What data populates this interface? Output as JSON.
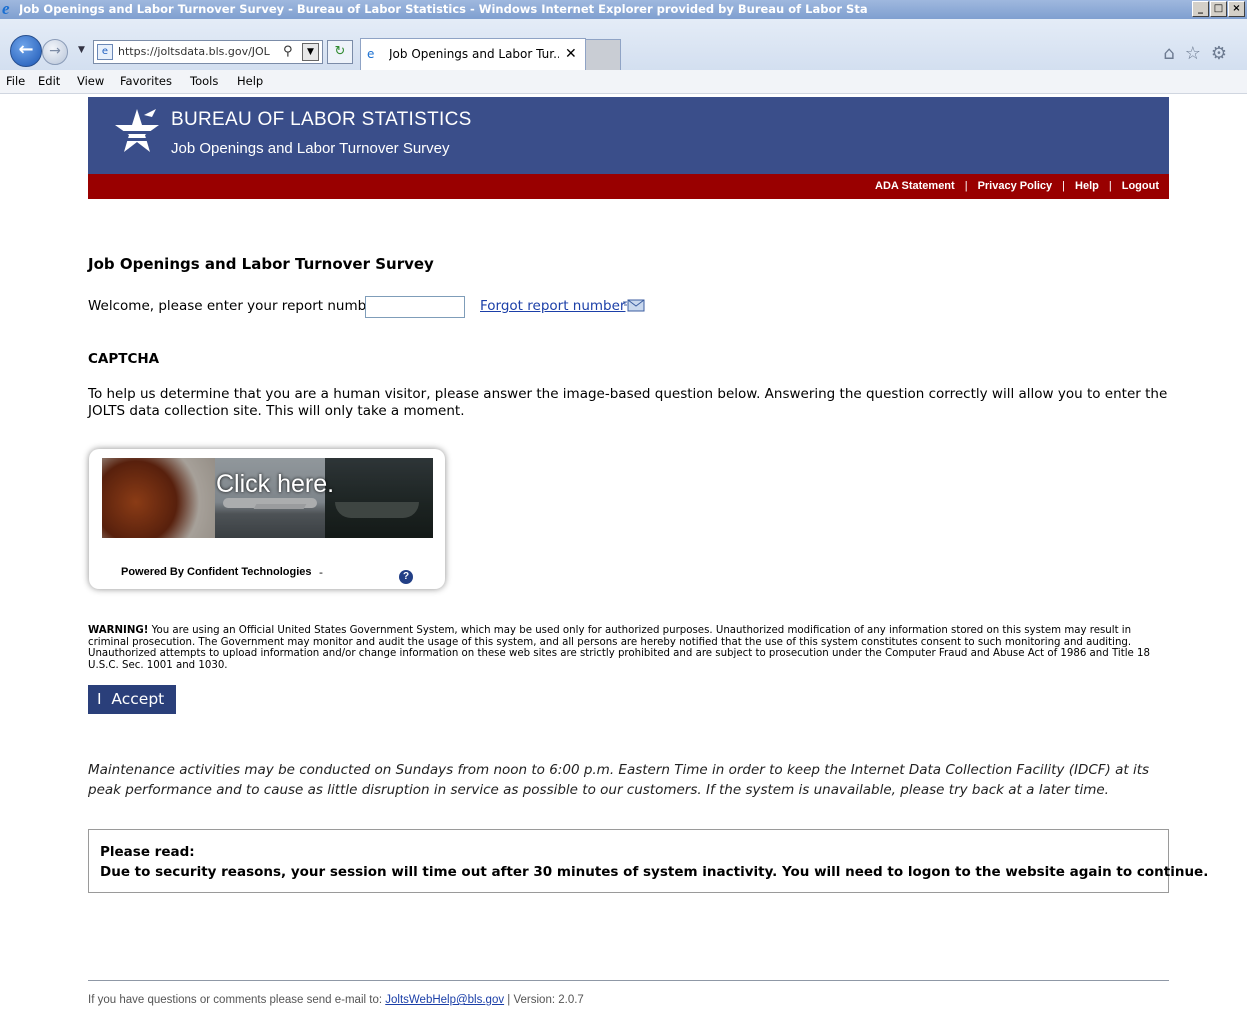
{
  "window": {
    "title": "Job Openings and Labor Turnover Survey - Bureau of Labor Statistics - Windows Internet Explorer provided by Bureau of Labor Sta",
    "controls": [
      "_",
      "□",
      "×"
    ]
  },
  "browser": {
    "address": "https://joltsdata.bls.gov/JOL",
    "tab_label": "Job Openings and Labor Tur...",
    "tab_close": "✕",
    "menu": {
      "file": "File",
      "edit": "Edit",
      "view": "View",
      "favorites": "Favorites",
      "tools": "Tools",
      "help": "Help"
    }
  },
  "header": {
    "agency": "BUREAU OF LABOR STATISTICS",
    "survey": "Job Openings and Labor Turnover Survey",
    "links": {
      "ada": "ADA Statement",
      "privacy": "Privacy Policy",
      "help": "Help",
      "logout": "Logout",
      "separator": "|"
    }
  },
  "main": {
    "title": "Job Openings and Labor Turnover Survey",
    "report_label": "Welcome, please enter your report number:",
    "report_value": "",
    "forgot_link": "Forgot report number",
    "captcha_heading": "CAPTCHA",
    "captcha_instructions": "To help us determine that you are a human visitor, please answer the image-based question below. Answering the question correctly will allow you to enter the JOLTS data collection site. This will only take a moment.",
    "captcha": {
      "prompt": "Click here.",
      "powered_by": "Powered By Confident Technologies",
      "dash": "-",
      "help": "?"
    },
    "warning_label": "WARNING!",
    "warning_text": " You are using an Official United States Government System, which may be used only for authorized purposes. Unauthorized modification of any information stored on this system may result in criminal prosecution. The Government may monitor and audit the usage of this system, and all persons are hereby notified that the use of this system constitutes consent to such monitoring and auditing. Unauthorized attempts to upload information and/or change information on these web sites are strictly prohibited and are subject to prosecution under the Computer Fraud and Abuse Act of 1986 and Title 18 U.S.C. Sec. 1001 and 1030.",
    "accept_button": "I  Accept",
    "maintenance": "Maintenance activities may be conducted on Sundays from noon to 6:00 p.m. Eastern Time in order to keep the Internet Data Collection Facility (IDCF) at its peak performance and to cause as little disruption in service as possible to our customers. If the system is unavailable, please try back at a later time.",
    "notice_title": "Please read:",
    "notice_text": "Due to security reasons, your session will time out after 30 minutes of system inactivity. You will need to logon to the website again to continue."
  },
  "footer": {
    "prefix": "If you have questions or comments please send e-mail to: ",
    "email": "JoltsWebHelp@bls.gov",
    "version": " | Version: 2.0.7"
  },
  "colors": {
    "banner": "#3a4e8a",
    "redbar": "#990000",
    "accept_button": "#2a3f7a",
    "link": "#1b3fa8"
  }
}
